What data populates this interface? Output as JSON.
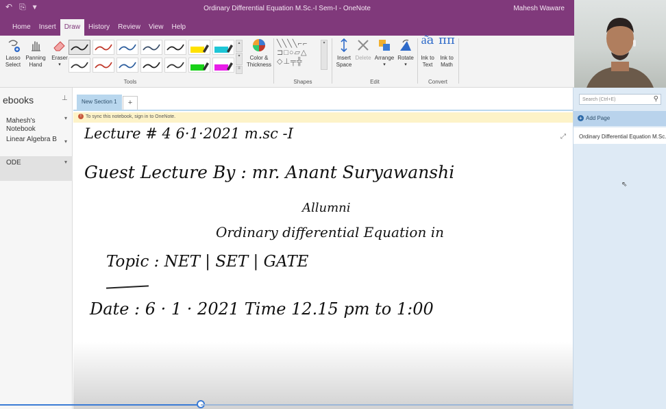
{
  "window": {
    "title": "Ordinary Differential Equation M.Sc.-I Sem-I  -  OneNote",
    "user": "Mahesh Waware"
  },
  "ribbon": {
    "tabs": [
      {
        "label": "Home"
      },
      {
        "label": "Insert"
      },
      {
        "label": "Draw"
      },
      {
        "label": "History"
      },
      {
        "label": "Review"
      },
      {
        "label": "View"
      },
      {
        "label": "Help"
      }
    ],
    "active_tab": "Draw",
    "tools": {
      "lasso": "Lasso\nSelect",
      "panning": "Panning\nHand",
      "eraser": "Eraser",
      "color": "Color &\nThickness",
      "insert_space": "Insert\nSpace",
      "delete": "Delete",
      "arrange": "Arrange",
      "rotate": "Rotate",
      "ink_to_text": "Ink to\nText",
      "ink_to_math": "Ink to\nMath"
    },
    "groups": {
      "tools": "Tools",
      "shapes": "Shapes",
      "edit": "Edit",
      "convert": "Convert"
    },
    "pen_colors": [
      "#222222",
      "#c0392b",
      "#2e5f9e",
      "#3b4f6a",
      "#222222",
      "#ffe100",
      "#1ec6d6",
      "#333333",
      "#c0392b",
      "#2e5f9e",
      "#222222",
      "#333333",
      "#19d119",
      "#e81ee8"
    ],
    "icons": {
      "lasso": "lasso-icon",
      "panning": "hand-icon",
      "eraser": "eraser-icon",
      "color": "color-wheel-icon",
      "insert_space": "insert-space-icon",
      "delete": "delete-icon",
      "arrange": "arrange-icon",
      "rotate": "rotate-icon",
      "ink_to_text": "ink-to-text-icon",
      "ink_to_math": "ink-to-math-icon"
    }
  },
  "nav": {
    "title": "ebooks",
    "notebooks": [
      {
        "label": "Mahesh's\nNotebook"
      },
      {
        "label": "Linear Algebra B"
      },
      {
        "label": "ODE"
      }
    ]
  },
  "section": {
    "tab_label": "New Section 1",
    "add_tab": "+"
  },
  "notice": {
    "text": "To sync this notebook, sign in to OneNote."
  },
  "page": {
    "ink_lines": [
      {
        "text": "Lecture # 4    6·1·2021      m.sc -I"
      },
      {
        "text": "Guest  Lecture  By  :  mr.  Anant  Suryawanshi"
      },
      {
        "text": "Allumni"
      },
      {
        "text": "Ordinary differential Equation in"
      },
      {
        "text": "Topic   :    NET | SET |  GATE"
      },
      {
        "text": "Date  :  6 · 1 · 2021          Time    12.15 pm  to 1:00"
      }
    ]
  },
  "pages_pane": {
    "search_placeholder": "Search (Ctrl+E)",
    "add_page": "Add Page",
    "pages": [
      {
        "title": "Ordinary Differential Equation M.Sc.-I"
      }
    ]
  },
  "video": {
    "progress": 0.35
  }
}
